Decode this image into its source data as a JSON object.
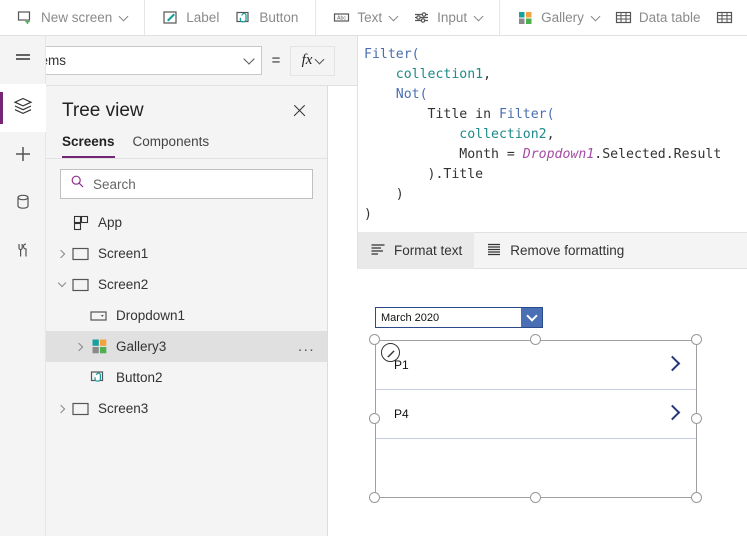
{
  "toolbar": {
    "groups": [
      {
        "items": [
          {
            "label": "New screen",
            "icon": "new-screen-icon",
            "caret": true
          }
        ]
      },
      {
        "items": [
          {
            "label": "Label",
            "icon": "label-pencil-icon",
            "caret": false
          },
          {
            "label": "Button",
            "icon": "button-cursor-icon",
            "caret": false
          }
        ]
      },
      {
        "items": [
          {
            "label": "Text",
            "icon": "text-abc-icon",
            "caret": true
          },
          {
            "label": "Input",
            "icon": "input-sliders-icon",
            "caret": true
          }
        ]
      },
      {
        "items": [
          {
            "label": "Gallery",
            "icon": "gallery-squares-icon",
            "caret": true
          },
          {
            "label": "Data table",
            "icon": "data-table-grid-icon",
            "caret": false
          }
        ]
      }
    ]
  },
  "property_bar": {
    "selected_property": "Items",
    "equals": "=",
    "fx_label": "fx"
  },
  "formula": {
    "lines": [
      [
        {
          "t": "Filter(",
          "c": "fn"
        }
      ],
      [
        {
          "t": "    ",
          "c": "plain"
        },
        {
          "t": "collection1",
          "c": "coll"
        },
        {
          "t": ",",
          "c": "plain"
        }
      ],
      [
        {
          "t": "    ",
          "c": "plain"
        },
        {
          "t": "Not(",
          "c": "fn"
        }
      ],
      [
        {
          "t": "        Title in ",
          "c": "plain"
        },
        {
          "t": "Filter(",
          "c": "fn"
        }
      ],
      [
        {
          "t": "            ",
          "c": "plain"
        },
        {
          "t": "collection2",
          "c": "coll"
        },
        {
          "t": ",",
          "c": "plain"
        }
      ],
      [
        {
          "t": "            Month = ",
          "c": "plain"
        },
        {
          "t": "Dropdown1",
          "c": "ctrl"
        },
        {
          "t": ".Selected.Result",
          "c": "plain"
        }
      ],
      [
        {
          "t": "        ).Title",
          "c": "plain"
        }
      ],
      [
        {
          "t": "    )",
          "c": "plain"
        }
      ],
      [
        {
          "t": ")",
          "c": "plain"
        }
      ]
    ]
  },
  "format_bar": {
    "format_text": "Format text",
    "remove_formatting": "Remove formatting"
  },
  "rail": {
    "items": [
      {
        "name": "hamburger-menu",
        "icon": "hamburger-icon",
        "active": false
      },
      {
        "name": "tree-view",
        "icon": "layers-icon",
        "active": true
      },
      {
        "name": "insert",
        "icon": "plus-icon",
        "active": false
      },
      {
        "name": "data",
        "icon": "database-icon",
        "active": false
      },
      {
        "name": "media",
        "icon": "tools-icon",
        "active": false
      }
    ]
  },
  "tree_view": {
    "title": "Tree view",
    "tabs": [
      {
        "label": "Screens",
        "active": true
      },
      {
        "label": "Components",
        "active": false
      }
    ],
    "search_placeholder": "Search",
    "items": [
      {
        "label": "App",
        "icon": "app-icon",
        "indent": 0,
        "twisty": "none",
        "selected": false,
        "menu": false
      },
      {
        "label": "Screen1",
        "icon": "screen-icon",
        "indent": 0,
        "twisty": "closed",
        "selected": false,
        "menu": false
      },
      {
        "label": "Screen2",
        "icon": "screen-icon",
        "indent": 0,
        "twisty": "open",
        "selected": false,
        "menu": false
      },
      {
        "label": "Dropdown1",
        "icon": "dropdown-icon",
        "indent": 1,
        "twisty": "none",
        "selected": false,
        "menu": false
      },
      {
        "label": "Gallery3",
        "icon": "gallery-icon",
        "indent": 1,
        "twisty": "closed",
        "selected": true,
        "menu": true
      },
      {
        "label": "Button2",
        "icon": "button-icon",
        "indent": 1,
        "twisty": "none",
        "selected": false,
        "menu": false
      },
      {
        "label": "Screen3",
        "icon": "screen-icon",
        "indent": 0,
        "twisty": "closed",
        "selected": false,
        "menu": false
      }
    ],
    "overflow_menu": "..."
  },
  "canvas": {
    "dropdown_value": "March 2020",
    "gallery_items": [
      {
        "label": "P1"
      },
      {
        "label": "P4"
      }
    ],
    "selected_control": "Gallery3"
  },
  "colors": {
    "accent_purple": "#742774",
    "teal": "#18a0a0",
    "green": "#4caf50",
    "orange": "#f2a33c",
    "formula_function": "#4a6fb0",
    "formula_collection": "#1f8a8a",
    "formula_control": "#a64ca6",
    "canvas_blue": "#4a6fb5",
    "chevron_navy": "#27377a"
  }
}
